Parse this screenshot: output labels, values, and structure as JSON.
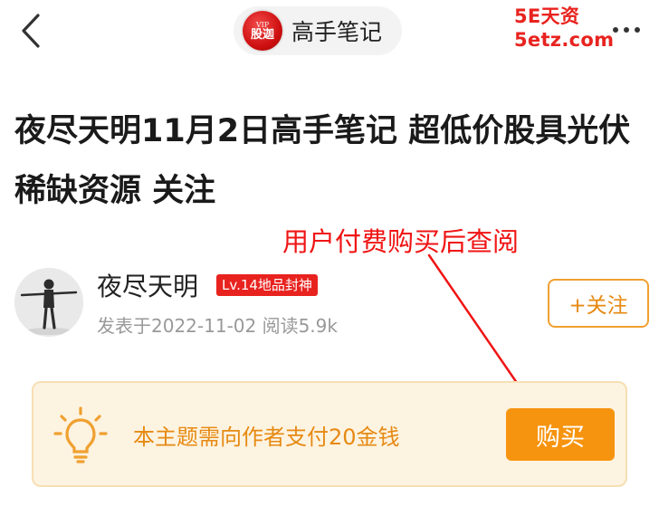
{
  "header": {
    "channel_logo_text_top": "VIP",
    "channel_logo_text_main": "股迦",
    "channel_name": "高手笔记",
    "icons": {
      "back": "chevron-left-icon",
      "more": "more-dots-icon"
    }
  },
  "watermark": "5E天资5etz.com",
  "post": {
    "title": "夜尽天明11月2日高手笔记 超低价股具光伏稀缺资源 关注"
  },
  "annotation": {
    "text": "用户付费购买后查阅",
    "color": "#f01414"
  },
  "author": {
    "name": "夜尽天明",
    "level_badge": "Lv.14地品封神",
    "meta": "发表于2022-11-02 阅读5.9k",
    "follow_label": "+关注"
  },
  "paywall": {
    "icon": "lightbulb-icon",
    "message": "本主题需向作者支付20金钱",
    "buy_label": "购买"
  },
  "colors": {
    "accent_orange": "#f7940f",
    "badge_red": "#e8231f",
    "paywall_bg": "#fdf3e1"
  }
}
